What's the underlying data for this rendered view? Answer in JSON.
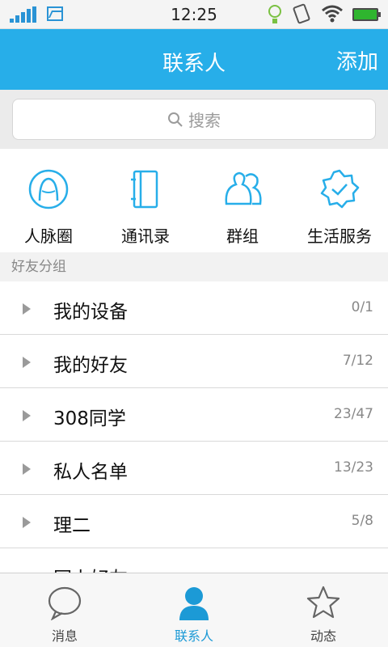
{
  "status": {
    "time": "12:25"
  },
  "header": {
    "title": "联系人",
    "add_label": "添加"
  },
  "search": {
    "placeholder": "搜索"
  },
  "quick_actions": [
    {
      "label": "人脉圈",
      "icon": "face-circle-icon"
    },
    {
      "label": "通讯录",
      "icon": "address-book-icon"
    },
    {
      "label": "群组",
      "icon": "group-icon"
    },
    {
      "label": "生活服务",
      "icon": "service-badge-icon"
    }
  ],
  "friend_groups": {
    "header": "好友分组",
    "items": [
      {
        "name": "我的设备",
        "count": "0/1"
      },
      {
        "name": "我的好友",
        "count": "7/12"
      },
      {
        "name": "308同学",
        "count": "23/47"
      },
      {
        "name": "私人名单",
        "count": "13/23"
      },
      {
        "name": "理二",
        "count": "5/8"
      },
      {
        "name": "网上好友",
        "count": ""
      }
    ]
  },
  "tabs": [
    {
      "label": "消息"
    },
    {
      "label": "联系人"
    },
    {
      "label": "动态"
    }
  ],
  "colors": {
    "accent": "#27aee9",
    "active_tab": "#1c9ad6"
  }
}
